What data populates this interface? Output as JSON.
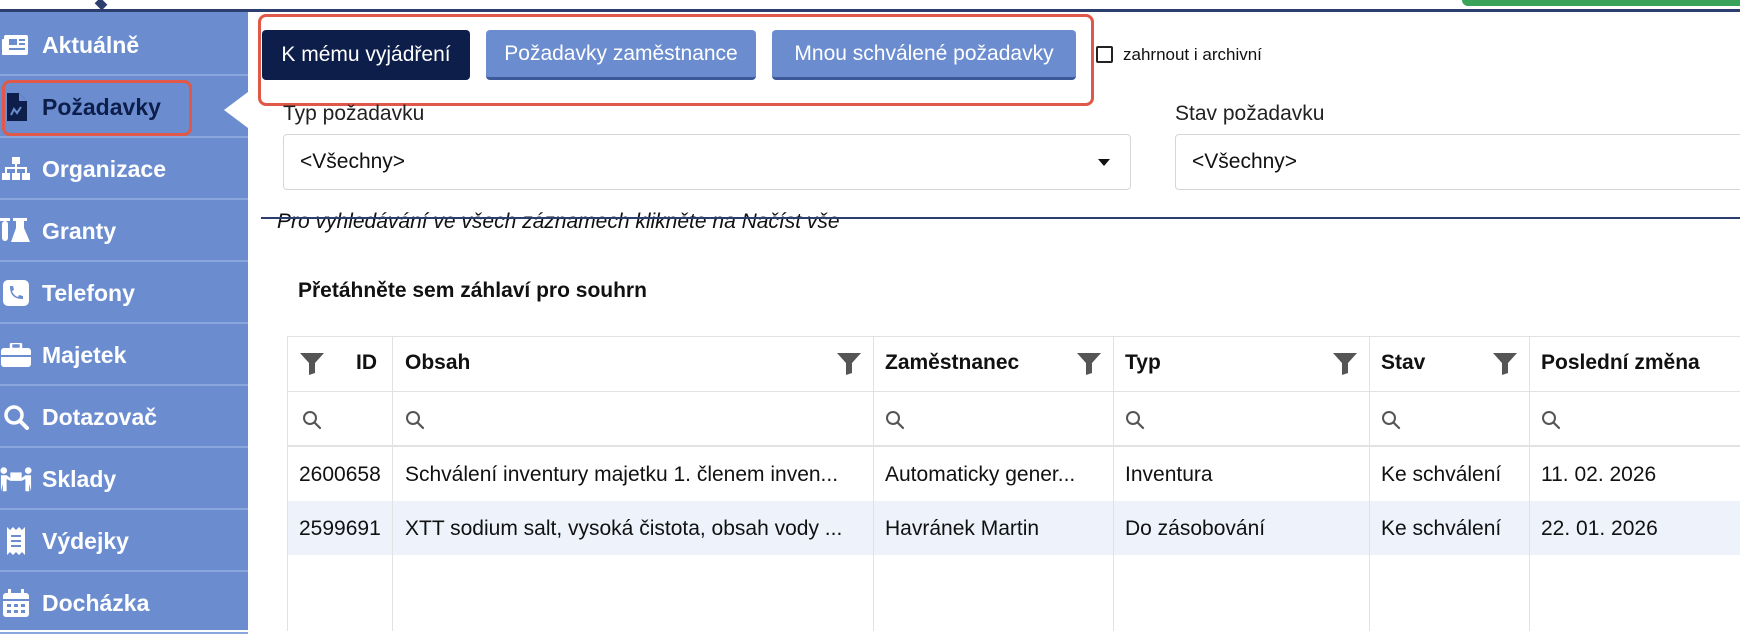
{
  "sidebar": {
    "items": [
      {
        "label": "Aktuálně",
        "icon": "newspaper-icon"
      },
      {
        "label": "Požadavky",
        "icon": "document-icon"
      },
      {
        "label": "Organizace",
        "icon": "org-chart-icon"
      },
      {
        "label": "Granty",
        "icon": "flask-icon"
      },
      {
        "label": "Telefony",
        "icon": "phone-icon"
      },
      {
        "label": "Majetek",
        "icon": "briefcase-icon"
      },
      {
        "label": "Dotazovač",
        "icon": "search-icon"
      },
      {
        "label": "Sklady",
        "icon": "people-carry-icon"
      },
      {
        "label": "Výdejky",
        "icon": "receipt-icon"
      },
      {
        "label": "Docházka",
        "icon": "calendar-icon"
      }
    ]
  },
  "toolbar": {
    "btn_my_opinion": "K mému vyjádření",
    "btn_employee_requests": "Požadavky zaměstnance",
    "btn_approved_by_me": "Mnou schválené požadavky",
    "include_archive_label": "zahrnout i archivní"
  },
  "filters": {
    "type_label": "Typ požadavku",
    "type_value": "<Všechny>",
    "state_label": "Stav požadavku",
    "state_value": "<Všechny>"
  },
  "hint_text": "Pro vyhledávání ve všech záznamech klikněte na Načíst vše",
  "group_hint": "Přetáhněte sem záhlaví pro souhrn",
  "table": {
    "columns": [
      "ID",
      "Obsah",
      "Zaměstnanec",
      "Typ",
      "Stav",
      "Poslední změna"
    ],
    "rows": [
      [
        "2600658",
        "Schválení inventury majetku 1. členem inven...",
        "Automaticky gener...",
        "Inventura",
        "Ke schválení",
        "11. 02. 2026"
      ],
      [
        "2599691",
        "XTT sodium salt, vysoká čistota, obsah vody ...",
        "Havránek Martin",
        "Do zásobování",
        "Ke schválení",
        "22. 01. 2026"
      ]
    ]
  },
  "colors": {
    "sidebar_bg": "#6b8dd0",
    "dark_button": "#0d1e4a",
    "highlight": "#e05848",
    "row_alt": "#edf2fb"
  }
}
